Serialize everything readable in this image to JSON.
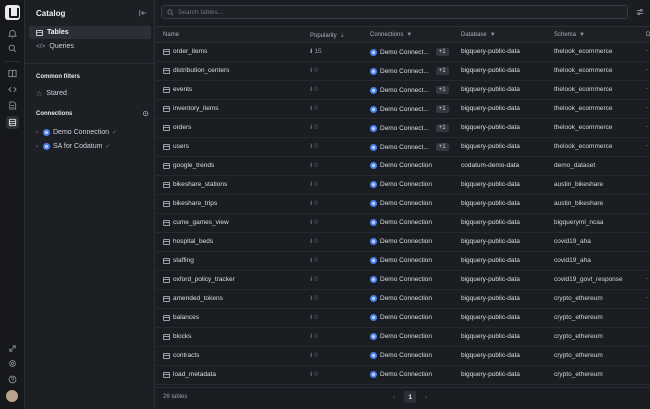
{
  "rail": {
    "icons": [
      "logo",
      "bell-icon",
      "search-icon",
      "book-icon",
      "code-icon",
      "file-icon",
      "database-icon",
      "puzzle-icon",
      "settings-icon",
      "help-icon"
    ]
  },
  "sidebar": {
    "title": "Catalog",
    "nav": [
      {
        "label": "Tables",
        "icon": "table-icon",
        "active": true
      },
      {
        "label": "Queries",
        "icon": "code-icon",
        "active": false
      }
    ],
    "common_filters_heading": "Common filters",
    "starred_label": "Stared",
    "connections_heading": "Connections",
    "connections": [
      {
        "label": "Demo Connection"
      },
      {
        "label": "SA for Codatum"
      }
    ]
  },
  "search": {
    "placeholder": "Search tables..."
  },
  "table": {
    "columns": {
      "name": "Name",
      "popularity": "Popularity",
      "connections": "Connections",
      "database": "Database",
      "schema": "Schema",
      "extra": "D"
    },
    "rows": [
      {
        "name": "order_items",
        "popularity": "15",
        "connection": "Demo Connect...",
        "extra_conn": "+1",
        "database": "bigquery-public-data",
        "schema": "thelook_ecommerce"
      },
      {
        "name": "distribution_centers",
        "popularity": "0",
        "connection": "Demo Connect...",
        "extra_conn": "+1",
        "database": "bigquery-public-data",
        "schema": "thelook_ecommerce"
      },
      {
        "name": "events",
        "popularity": "0",
        "connection": "Demo Connect...",
        "extra_conn": "+1",
        "database": "bigquery-public-data",
        "schema": "thelook_ecommerce"
      },
      {
        "name": "inventory_items",
        "popularity": "0",
        "connection": "Demo Connect...",
        "extra_conn": "+1",
        "database": "bigquery-public-data",
        "schema": "thelook_ecommerce"
      },
      {
        "name": "orders",
        "popularity": "0",
        "connection": "Demo Connect...",
        "extra_conn": "+1",
        "database": "bigquery-public-data",
        "schema": "thelook_ecommerce"
      },
      {
        "name": "users",
        "popularity": "0",
        "connection": "Demo Connect...",
        "extra_conn": "+1",
        "database": "bigquery-public-data",
        "schema": "thelook_ecommerce"
      },
      {
        "name": "google_trends",
        "popularity": "0",
        "connection": "Demo Connection",
        "extra_conn": "",
        "database": "codatum-demo-data",
        "schema": "demo_dataset"
      },
      {
        "name": "bikeshare_stations",
        "popularity": "0",
        "connection": "Demo Connection",
        "extra_conn": "",
        "database": "bigquery-public-data",
        "schema": "austin_bikeshare"
      },
      {
        "name": "bikeshare_trips",
        "popularity": "0",
        "connection": "Demo Connection",
        "extra_conn": "",
        "database": "bigquery-public-data",
        "schema": "austin_bikeshare"
      },
      {
        "name": "cume_games_view",
        "popularity": "0",
        "connection": "Demo Connection",
        "extra_conn": "",
        "database": "bigquery-public-data",
        "schema": "bigqueryml_ncaa"
      },
      {
        "name": "hospital_beds",
        "popularity": "0",
        "connection": "Demo Connection",
        "extra_conn": "",
        "database": "bigquery-public-data",
        "schema": "covid19_aha"
      },
      {
        "name": "staffing",
        "popularity": "0",
        "connection": "Demo Connection",
        "extra_conn": "",
        "database": "bigquery-public-data",
        "schema": "covid19_aha"
      },
      {
        "name": "oxford_policy_tracker",
        "popularity": "0",
        "connection": "Demo Connection",
        "extra_conn": "",
        "database": "bigquery-public-data",
        "schema": "covid19_govt_response"
      },
      {
        "name": "amended_tokens",
        "popularity": "0",
        "connection": "Demo Connection",
        "extra_conn": "",
        "database": "bigquery-public-data",
        "schema": "crypto_ethereum"
      },
      {
        "name": "balances",
        "popularity": "0",
        "connection": "Demo Connection",
        "extra_conn": "",
        "database": "bigquery-public-data",
        "schema": "crypto_ethereum"
      },
      {
        "name": "blocks",
        "popularity": "0",
        "connection": "Demo Connection",
        "extra_conn": "",
        "database": "bigquery-public-data",
        "schema": "crypto_ethereum"
      },
      {
        "name": "contracts",
        "popularity": "0",
        "connection": "Demo Connection",
        "extra_conn": "",
        "database": "bigquery-public-data",
        "schema": "crypto_ethereum"
      },
      {
        "name": "load_metadata",
        "popularity": "0",
        "connection": "Demo Connection",
        "extra_conn": "",
        "database": "bigquery-public-data",
        "schema": "crypto_ethereum"
      }
    ]
  },
  "footer": {
    "count_label": "26 tables",
    "current_page": "1"
  },
  "colors": {
    "accent": "#4e82ee",
    "background": "#1a1d22",
    "sidebar": "#1c1f24"
  }
}
